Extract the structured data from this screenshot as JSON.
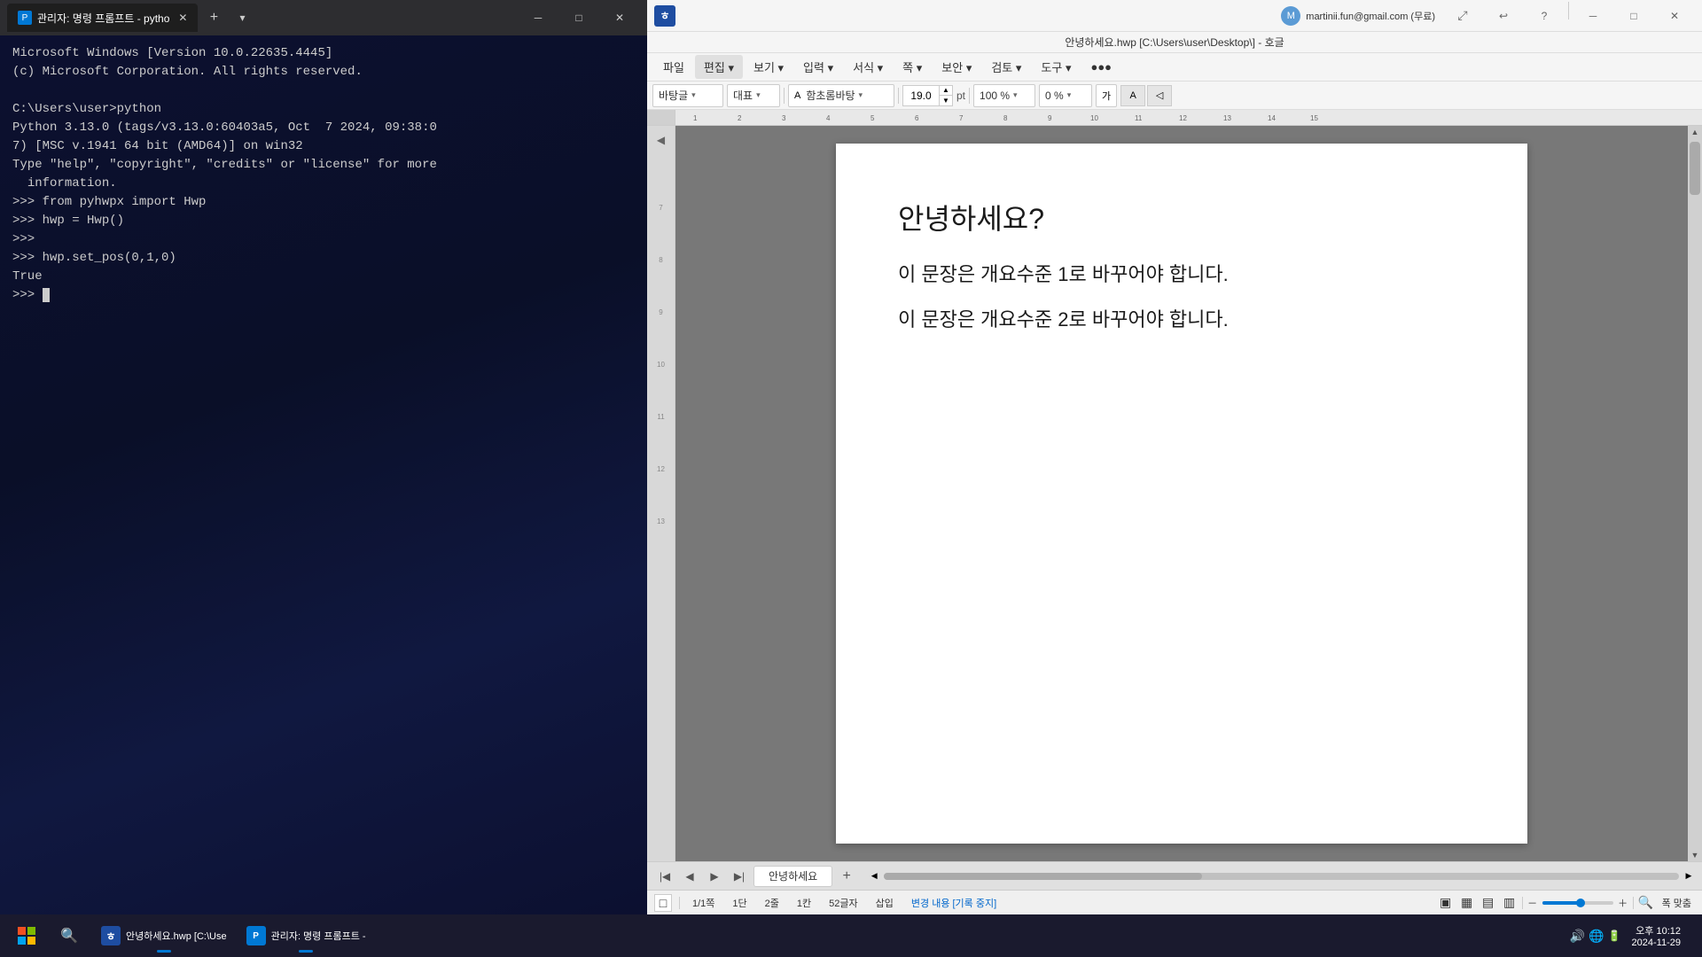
{
  "taskbar": {
    "apps": [
      {
        "id": "start",
        "label": "Start"
      },
      {
        "id": "search",
        "label": "Search"
      },
      {
        "id": "hwp",
        "label": "안녕하세요.hwp [C:\\Use",
        "active": true
      },
      {
        "id": "terminal",
        "label": "관리자: 명령 프롬프트 -",
        "active": true
      }
    ],
    "time": "오후 10:12",
    "date": "2024-11-29"
  },
  "terminal": {
    "title": "관리자: 명령 프롬프트 - pytho",
    "tab_label": "관리자: 명령 프롬프트 - pytho",
    "lines": [
      "Microsoft Windows [Version 10.0.22635.4445]",
      "(c) Microsoft Corporation. All rights reserved.",
      "",
      "C:\\Users\\user>python",
      "Python 3.13.0 (tags/v3.13.0:60403a5, Oct  7 2024, 09:38:0",
      "7) [MSC v.1941 64 bit (AMD64)] on win32",
      "Type \"help\", \"copyright\", \"credits\" or \"license\" for more",
      "  information.",
      ">>> from pyhwpx import Hwp",
      ">>> hwp = Hwp()",
      ">>> ",
      ">>> hwp.set_pos(0,1,0)",
      "True",
      ">>> "
    ]
  },
  "hwp": {
    "title": "안녕하세요.hwp [C:\\Users\\user\\Desktop\\] - 호글",
    "account": "martinii.fun@gmail.com (무료)",
    "menus": [
      "파일",
      "편집",
      "보기",
      "입력",
      "서식",
      "쪽",
      "보안",
      "검토",
      "도구",
      "●●●"
    ],
    "toolbar": {
      "font": "바탕글",
      "font_type": "대표",
      "font_family": "함초롬바탕",
      "font_size": "19.0",
      "font_unit": "pt",
      "zoom": "100 %",
      "rotation": "0 %",
      "char_label": "가"
    },
    "document": {
      "heading": "안녕하세요?",
      "para1": "이  문장은  개요수준  1로  바꾸어야  합니다.",
      "para2": "이  문장은  개요수준  2로  바꾸어야  합니다."
    },
    "statusbar": {
      "page": "1/1쪽",
      "column": "1단",
      "line": "2줄",
      "col": "1칸",
      "chars": "52글자",
      "mode": "삽입",
      "track_changes": "변경 내용 [기록 중지]"
    },
    "page_tab": "안녕하세요"
  }
}
